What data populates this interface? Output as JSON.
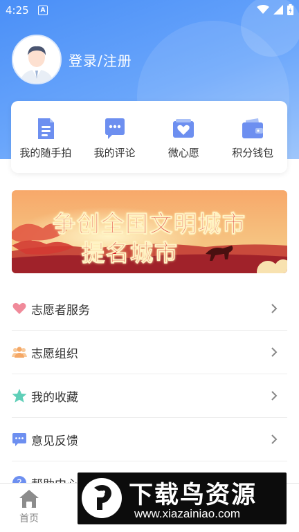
{
  "status_bar": {
    "time": "4:25",
    "notification_icon": "A"
  },
  "profile": {
    "login_text": "登录/注册"
  },
  "quick_actions": [
    {
      "label": "我的随手拍",
      "icon": "document-icon"
    },
    {
      "label": "我的评论",
      "icon": "comment-icon"
    },
    {
      "label": "微心愿",
      "icon": "heart-card-icon"
    },
    {
      "label": "积分钱包",
      "icon": "wallet-icon"
    }
  ],
  "banner": {
    "line1": "争创全国文明城市",
    "line2": "提名城市"
  },
  "menu": [
    {
      "label": "志愿者服务",
      "icon": "heart-icon",
      "color": "#f08a9a"
    },
    {
      "label": "志愿组织",
      "icon": "group-icon",
      "color": "#f5b67a"
    },
    {
      "label": "我的收藏",
      "icon": "star-icon",
      "color": "#5fcfb8"
    },
    {
      "label": "意见反馈",
      "icon": "feedback-icon",
      "color": "#6d8ff0"
    },
    {
      "label": "帮助中心",
      "icon": "help-icon",
      "color": "#6d8ff0"
    }
  ],
  "tabbar": {
    "home_label": "首页"
  },
  "watermark": {
    "title": "下载鸟资源",
    "url": "www.xiazainiao.com"
  },
  "colors": {
    "header_blue": "#4a8ff7",
    "icon_blue": "#6d8ff0",
    "banner_red": "#d7141c"
  }
}
